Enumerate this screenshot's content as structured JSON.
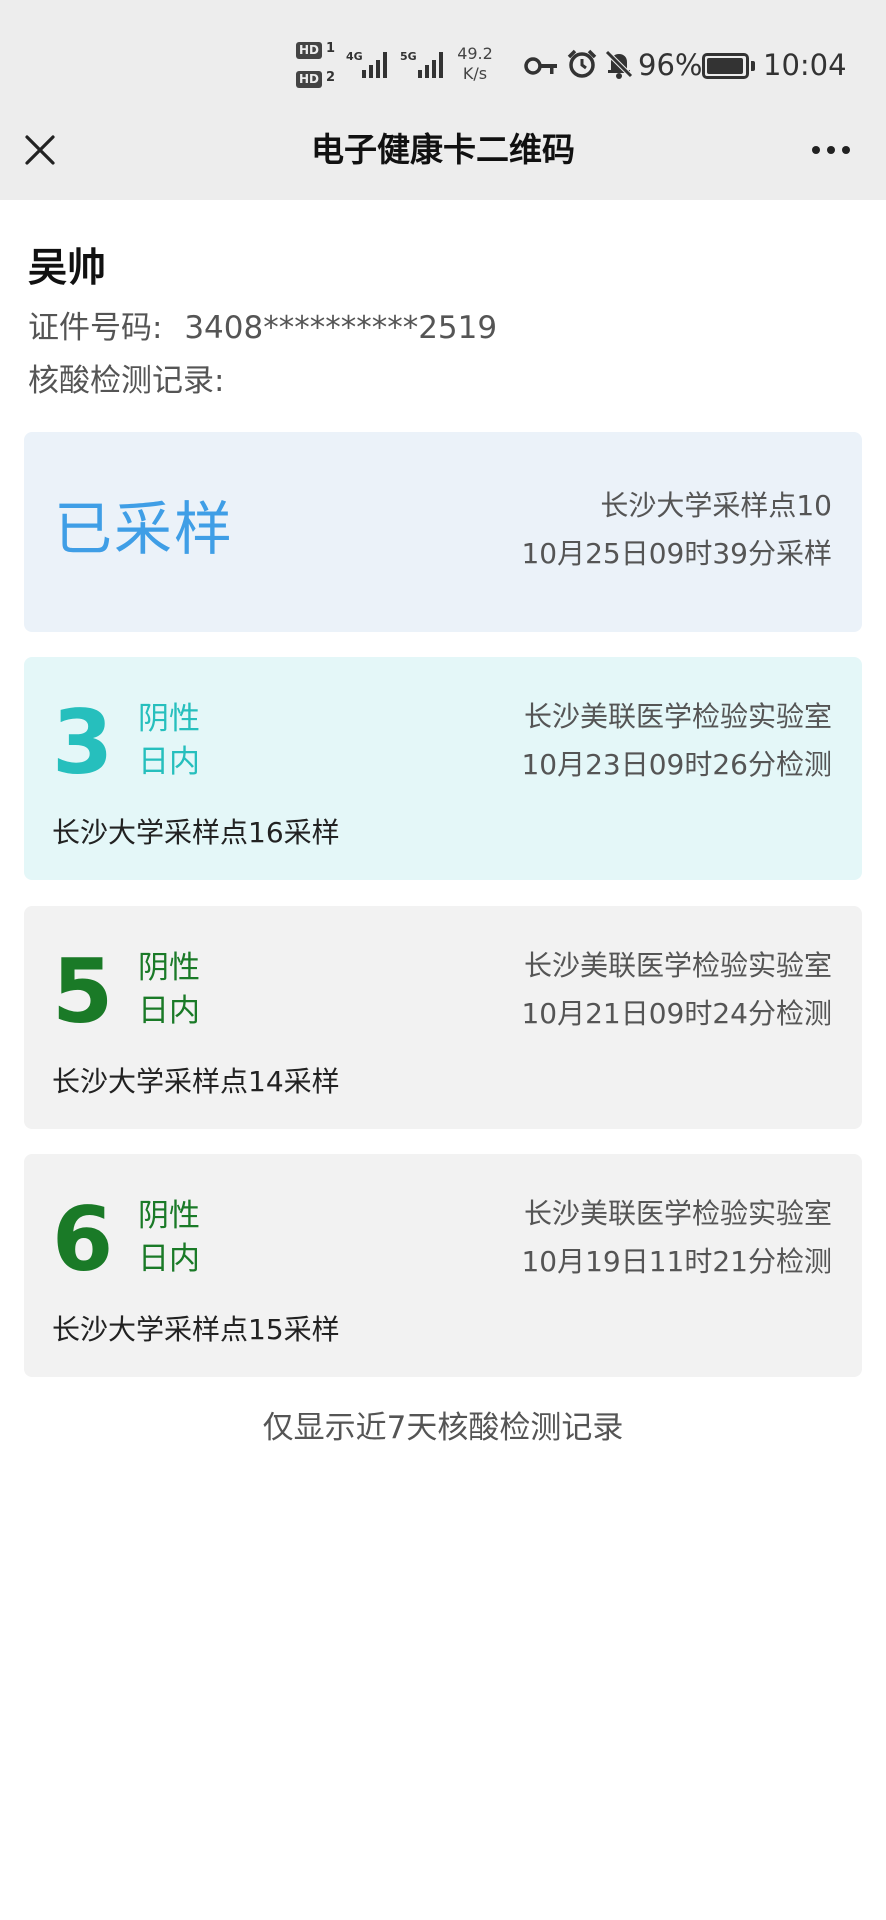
{
  "status_bar": {
    "hd1": "HD",
    "hd1_num": "1",
    "hd2": "HD",
    "hd2_num": "2",
    "net1": "4G",
    "net2": "5G",
    "speed_value": "49.2",
    "speed_unit": "K/s",
    "battery": "96%",
    "battery_level": 0.96,
    "time": "10:04",
    "icons": [
      "key-icon",
      "alarm-icon",
      "mute-bell-icon",
      "battery-icon"
    ]
  },
  "nav": {
    "title": "电子健康卡二维码",
    "close_icon": "close-icon",
    "more_icon": "more-icon"
  },
  "profile": {
    "name": "吴帅",
    "id_label": "证件号码:",
    "id_value": "3408**********2519",
    "record_title": "核酸检测记录:"
  },
  "sampled": {
    "status": "已采样",
    "site": "长沙大学采样点10",
    "time": "10月25日09时39分采样"
  },
  "tests": [
    {
      "days": "3",
      "result": "阴性",
      "within": "日内",
      "lab": "长沙美联医学检验实验室",
      "time": "10月23日09时26分检测",
      "site": "长沙大学采样点16采样",
      "color": "#26bfbd"
    },
    {
      "days": "5",
      "result": "阴性",
      "within": "日内",
      "lab": "长沙美联医学检验实验室",
      "time": "10月21日09时24分检测",
      "site": "长沙大学采样点14采样",
      "color": "#1a7a27"
    },
    {
      "days": "6",
      "result": "阴性",
      "within": "日内",
      "lab": "长沙美联医学检验实验室",
      "time": "10月19日11时21分检测",
      "site": "长沙大学采样点15采样",
      "color": "#1a7a27"
    }
  ],
  "footnote": "仅显示近7天核酸检测记录",
  "colors": {
    "sampled_text": "#3f9ee6",
    "sampled_bg": "#ebf2f9",
    "recent_bg": "#e4f7f8",
    "card_bg": "#f2f2f2",
    "bar_bg": "#ededed"
  }
}
